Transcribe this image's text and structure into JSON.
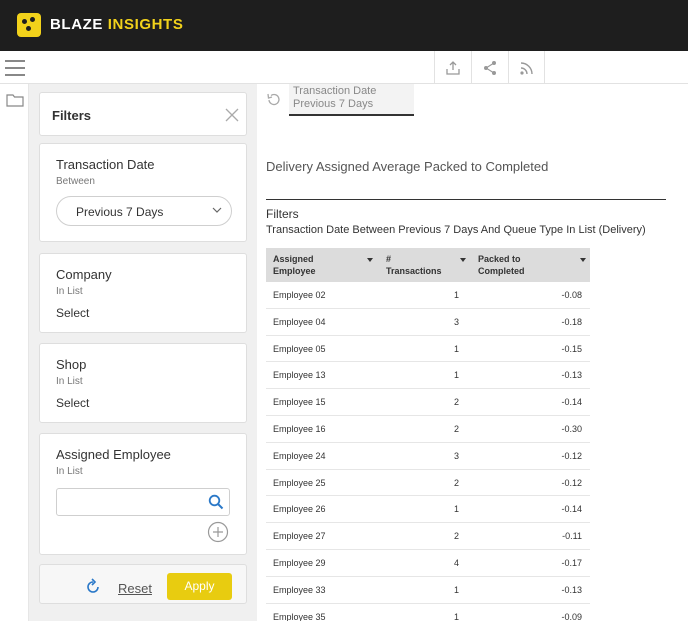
{
  "header": {
    "brand_word1": "BLAZE",
    "brand_word2": "INSIGHTS",
    "accent_color": "#f2d21b",
    "bar_color": "#1e1e1e"
  },
  "toolbar": {
    "icons": [
      "menu-icon",
      "export-icon",
      "share-icon",
      "rss-icon"
    ]
  },
  "filters_panel": {
    "title": "Filters",
    "cards": [
      {
        "title": "Transaction Date",
        "operator": "Between",
        "value": "Previous 7 Days"
      },
      {
        "title": "Company",
        "operator": "In List",
        "value": "Select"
      },
      {
        "title": "Shop",
        "operator": "In List",
        "value": "Select"
      },
      {
        "title": "Assigned Employee",
        "operator": "In List",
        "search_value": ""
      }
    ],
    "reset_label": "Reset",
    "apply_label": "Apply",
    "apply_color": "#e8cc10"
  },
  "tab": {
    "line1": "Transaction Date",
    "line2": "Previous 7 Days"
  },
  "report": {
    "title": "Delivery Assigned Average Packed to Completed",
    "filters_label": "Filters",
    "filters_description": "Transaction Date Between Previous 7 Days And Queue Type In List (Delivery)",
    "columns": [
      {
        "line1": "Assigned",
        "line2": "Employee"
      },
      {
        "line1": "#",
        "line2": "Transactions"
      },
      {
        "line1": "Packed to",
        "line2": "Completed"
      }
    ],
    "rows": [
      {
        "employee": "Employee 02",
        "transactions": "1",
        "packed": "-0.08"
      },
      {
        "employee": "Employee 04",
        "transactions": "3",
        "packed": "-0.18"
      },
      {
        "employee": "Employee 05",
        "transactions": "1",
        "packed": "-0.15"
      },
      {
        "employee": "Employee 13",
        "transactions": "1",
        "packed": "-0.13"
      },
      {
        "employee": "Employee 15",
        "transactions": "2",
        "packed": "-0.14"
      },
      {
        "employee": "Employee 16",
        "transactions": "2",
        "packed": "-0.30"
      },
      {
        "employee": "Employee 24",
        "transactions": "3",
        "packed": "-0.12"
      },
      {
        "employee": "Employee 25",
        "transactions": "2",
        "packed": "-0.12"
      },
      {
        "employee": "Employee 26",
        "transactions": "1",
        "packed": "-0.14"
      },
      {
        "employee": "Employee 27",
        "transactions": "2",
        "packed": "-0.11"
      },
      {
        "employee": "Employee 29",
        "transactions": "4",
        "packed": "-0.17"
      },
      {
        "employee": "Employee 33",
        "transactions": "1",
        "packed": "-0.13"
      },
      {
        "employee": "Employee 35",
        "transactions": "1",
        "packed": "-0.09"
      }
    ]
  }
}
